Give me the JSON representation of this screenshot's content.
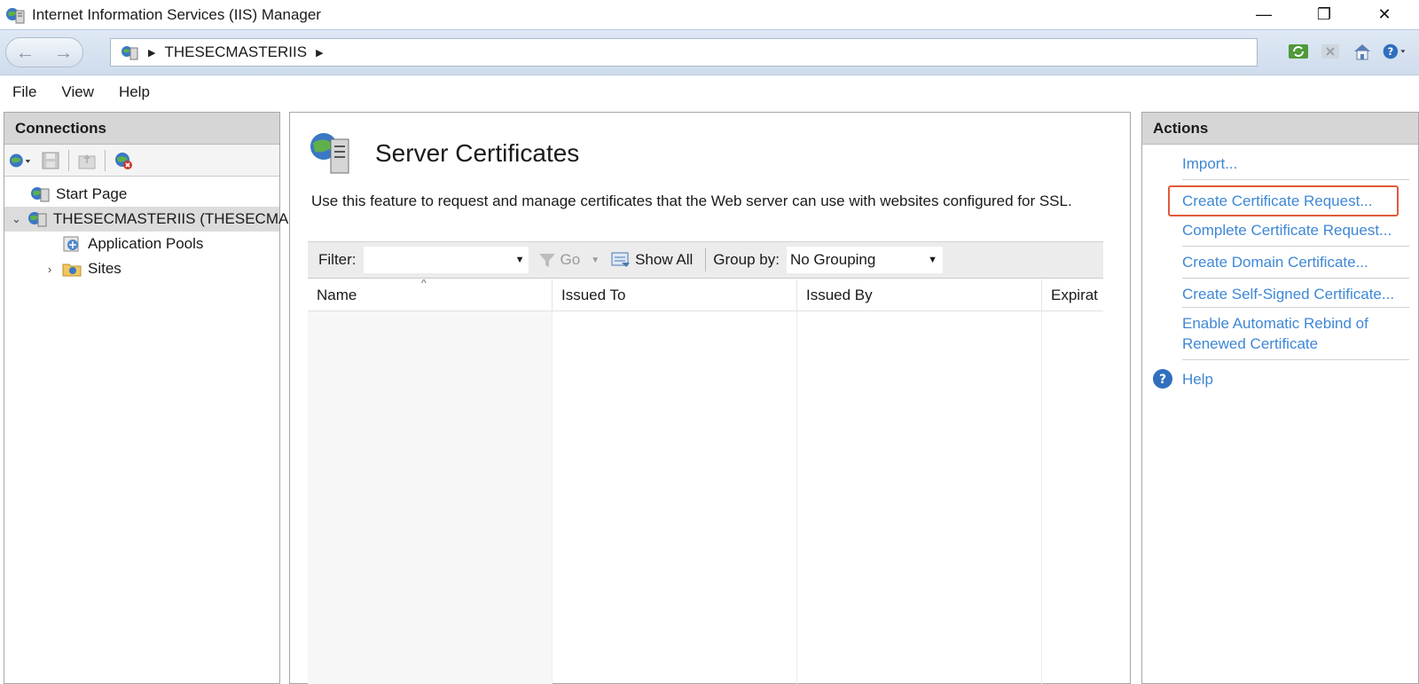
{
  "window": {
    "title": "Internet Information Services (IIS) Manager",
    "minimize": "—",
    "maximize": "❐",
    "close": "✕"
  },
  "address": {
    "crumbs": [
      "THESECMASTERIIS"
    ],
    "separator": "▶"
  },
  "menu": {
    "items": [
      "File",
      "View",
      "Help"
    ]
  },
  "connections": {
    "header": "Connections",
    "tree": [
      {
        "label": "Start Page",
        "icon": "start-page-icon"
      },
      {
        "label": "THESECMASTERIIS (THESECMASTERIIS\\Administrator)",
        "icon": "server-icon",
        "expanded": true,
        "selected": true
      },
      {
        "label": "Application Pools",
        "icon": "app-pool-icon"
      },
      {
        "label": "Sites",
        "icon": "sites-folder-icon",
        "collapsed": true
      }
    ]
  },
  "feature": {
    "title": "Server Certificates",
    "description": "Use this feature to request and manage certificates that the Web server can use with websites configured for SSL.",
    "filter_label": "Filter:",
    "filter_value": "",
    "go_label": "Go",
    "show_all_label": "Show All",
    "group_by_label": "Group by:",
    "group_by_value": "No Grouping",
    "columns": [
      "Name",
      "Issued To",
      "Issued By",
      "Expirat"
    ]
  },
  "actions": {
    "header": "Actions",
    "items": [
      "Import...",
      "Create Certificate Request...",
      "Complete Certificate Request...",
      "Create Domain Certificate...",
      "Create Self-Signed Certificate...",
      "Enable Automatic Rebind of Renewed Certificate",
      "Help"
    ],
    "link_color": "#3e87d6",
    "highlight_color": "#e05a3a"
  }
}
